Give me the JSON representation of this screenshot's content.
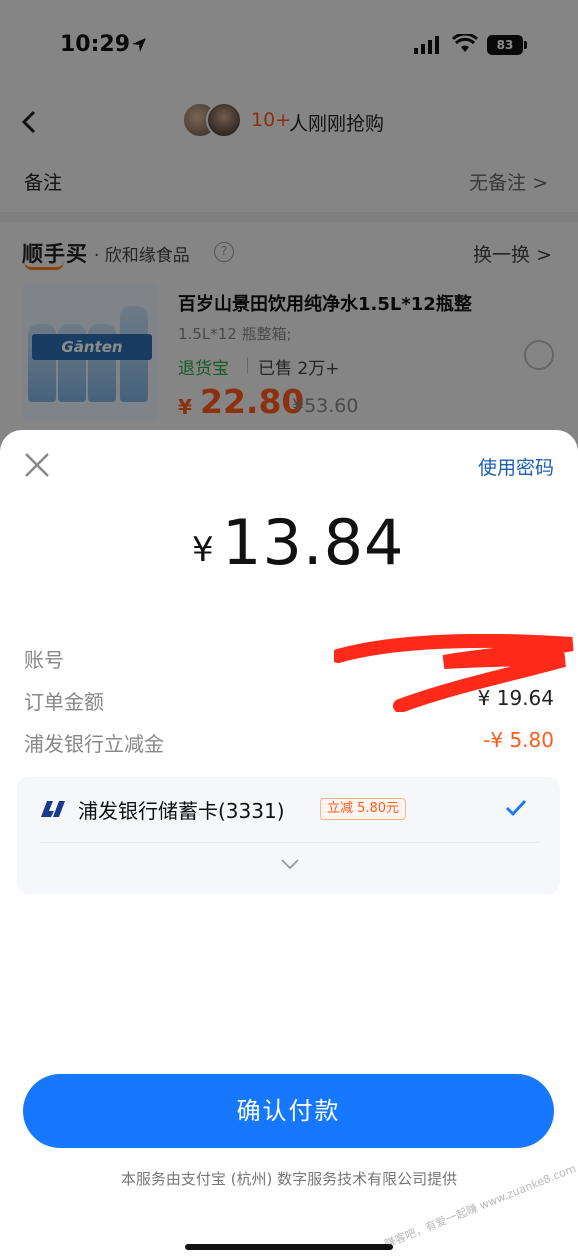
{
  "status_bar": {
    "time": "10:29",
    "battery": "83"
  },
  "header": {
    "buy_count": "10+",
    "buy_text": "人刚刚抢购"
  },
  "remark": {
    "label": "备注",
    "value": "无备注 >"
  },
  "shop": {
    "logo": "顺手买",
    "name": "· 欣和缘食品",
    "help": "?",
    "swap": "换一换 >"
  },
  "product": {
    "image_label": "Gānten",
    "title": "百岁山景田饮用纯净水1.5L*12瓶整",
    "spec": "1.5L*12 瓶整箱;",
    "return_tag": "退货宝",
    "sold": "已售 2万+",
    "price_symbol": "¥",
    "price": "22.80",
    "original_price": "¥53.60"
  },
  "payment": {
    "use_password": "使用密码",
    "amount_symbol": "¥",
    "amount": "13.84",
    "rows": [
      {
        "label": "账号",
        "value": ""
      },
      {
        "label": "订单金额",
        "value": "¥ 19.64"
      },
      {
        "label": "浦发银行立减金",
        "value": "-¥ 5.80"
      }
    ],
    "card": {
      "name": "浦发银行储蓄卡(3331)",
      "badge": "立减 5.80元"
    },
    "confirm_label": "确认付款",
    "footer": "本服务由支付宝 (杭州) 数字服务技术有限公司提供",
    "watermark": "赚客吧，有爱一起赚 www.zuanke8.com"
  },
  "colors": {
    "accent": "#1677ff",
    "price": "#ff5a1e",
    "success": "#2aa34a"
  }
}
